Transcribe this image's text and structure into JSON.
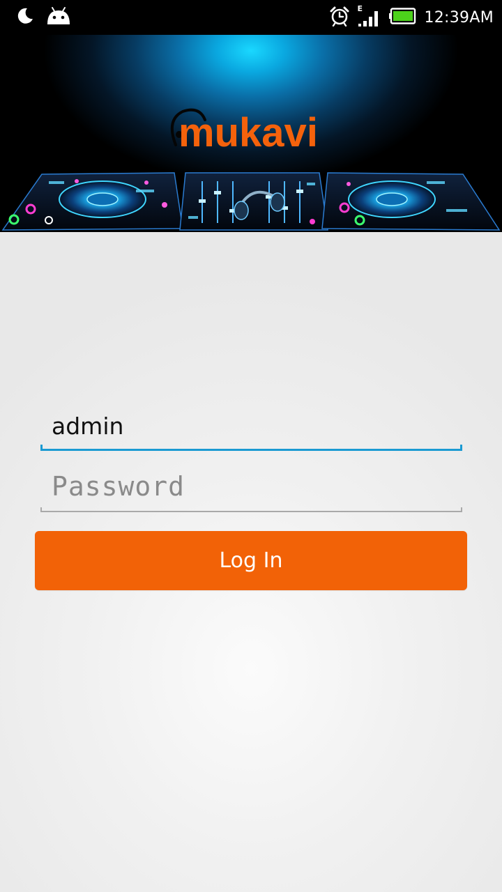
{
  "status_bar": {
    "time": "12:39AM",
    "network_type": "E",
    "left_icons": [
      "moon-icon",
      "android-icon"
    ],
    "right_icons": [
      "alarm-icon",
      "signal-icon",
      "battery-icon"
    ],
    "battery_color": "#4cd11b"
  },
  "banner": {
    "logo_text": "mukavi",
    "logo_color": "#f4620c",
    "glow_color": "#1ad8ff"
  },
  "login_form": {
    "username": {
      "value": "admin",
      "placeholder": ""
    },
    "password": {
      "value": "",
      "placeholder": "Password"
    },
    "login_button_label": "Log In",
    "accent_color": "#f26207",
    "focus_color": "#1a9ad2"
  }
}
